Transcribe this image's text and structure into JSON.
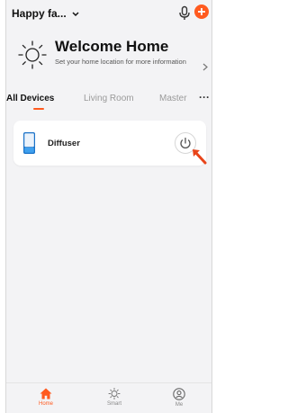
{
  "header": {
    "home_name": "Happy fa...",
    "icons": [
      "chevron-down-icon",
      "microphone-icon",
      "add-icon"
    ]
  },
  "welcome": {
    "title": "Welcome Home",
    "subtitle": "Set your home location for more information",
    "icon": "sun-icon"
  },
  "tabs": [
    {
      "label": "All Devices",
      "active": true
    },
    {
      "label": "Living Room",
      "active": false
    },
    {
      "label": "Master",
      "active": false
    }
  ],
  "devices": [
    {
      "name": "Diffuser",
      "icon": "diffuser-icon",
      "action_icon": "power-icon"
    }
  ],
  "bottom_nav": [
    {
      "label": "Home",
      "icon": "home-icon",
      "active": true
    },
    {
      "label": "Smart",
      "icon": "smart-icon",
      "active": false
    },
    {
      "label": "Me",
      "icon": "me-icon",
      "active": false
    }
  ],
  "colors": {
    "accent": "#ff5a1f",
    "background": "#f3f3f5",
    "card": "#ffffff"
  }
}
